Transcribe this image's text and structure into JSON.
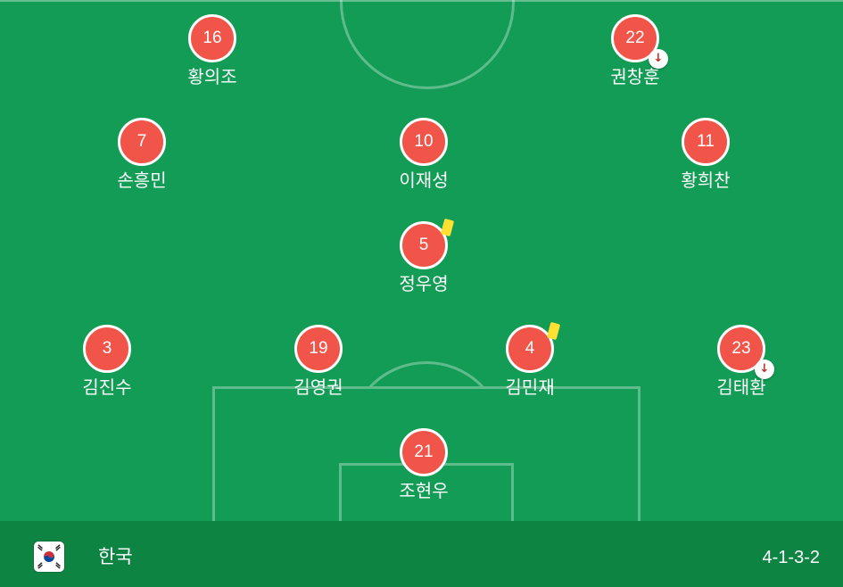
{
  "team": {
    "name": "한국",
    "formation": "4-1-3-2",
    "flag_icon": "south-korea-flag-icon"
  },
  "colors": {
    "pitch": "#139c55",
    "footer": "#0e8443",
    "player_badge": "#f1554a",
    "yellow_card": "#ffe033",
    "sub_arrow": "#c62828"
  },
  "players": [
    {
      "number": "16",
      "name": "황의조",
      "sub_off": false,
      "yellow_card": false
    },
    {
      "number": "22",
      "name": "권창훈",
      "sub_off": true,
      "yellow_card": false
    },
    {
      "number": "7",
      "name": "손흥민",
      "sub_off": false,
      "yellow_card": false
    },
    {
      "number": "10",
      "name": "이재성",
      "sub_off": false,
      "yellow_card": false
    },
    {
      "number": "11",
      "name": "황희찬",
      "sub_off": false,
      "yellow_card": false
    },
    {
      "number": "5",
      "name": "정우영",
      "sub_off": false,
      "yellow_card": true
    },
    {
      "number": "3",
      "name": "김진수",
      "sub_off": false,
      "yellow_card": false
    },
    {
      "number": "19",
      "name": "김영권",
      "sub_off": false,
      "yellow_card": false
    },
    {
      "number": "4",
      "name": "김민재",
      "sub_off": false,
      "yellow_card": true
    },
    {
      "number": "23",
      "name": "김태환",
      "sub_off": true,
      "yellow_card": false
    },
    {
      "number": "21",
      "name": "조현우",
      "sub_off": false,
      "yellow_card": false
    }
  ]
}
